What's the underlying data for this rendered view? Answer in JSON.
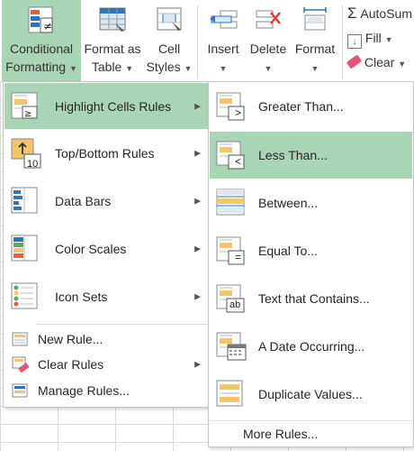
{
  "ribbon": {
    "conditional_formatting": {
      "line1": "Conditional",
      "line2": "Formatting"
    },
    "format_as_table": {
      "line1": "Format as",
      "line2": "Table"
    },
    "cell_styles": {
      "line1": "Cell",
      "line2": "Styles"
    },
    "insert": "Insert",
    "delete": "Delete",
    "format": "Format",
    "autosum": "AutoSum",
    "fill": "Fill",
    "clear": "Clear"
  },
  "main_menu": {
    "items": [
      {
        "label": "Highlight Cells Rules",
        "key": "H"
      },
      {
        "label": "Top/Bottom Rules",
        "key": "T"
      },
      {
        "label": "Data Bars",
        "key": "D"
      },
      {
        "label": "Color Scales",
        "key": "S"
      },
      {
        "label": "Icon Sets",
        "key": "I"
      }
    ],
    "small_items": [
      {
        "label": "New Rule...",
        "key": "N"
      },
      {
        "label": "Clear Rules",
        "key": "C"
      },
      {
        "label": "Manage Rules...",
        "key": "R"
      }
    ],
    "top10_badge": "10"
  },
  "sub_menu": {
    "items": [
      {
        "label": "Greater Than...",
        "key": "G"
      },
      {
        "label": "Less Than...",
        "key": "L"
      },
      {
        "label": "Between...",
        "key": "B"
      },
      {
        "label": "Equal To...",
        "key": "E"
      },
      {
        "label": "Text that Contains...",
        "key": "T"
      },
      {
        "label": "A Date Occurring...",
        "key": "A"
      },
      {
        "label": "Duplicate Values...",
        "key": "D"
      }
    ],
    "more_rules": "More Rules...",
    "badges": {
      "gt": ">",
      "lt": "<",
      "eq": "=",
      "ab": "ab"
    }
  },
  "colors": {
    "highlight": "#a9d5b7",
    "accent_blue": "#2e75b6",
    "cell_yellow": "#f2c46b"
  }
}
